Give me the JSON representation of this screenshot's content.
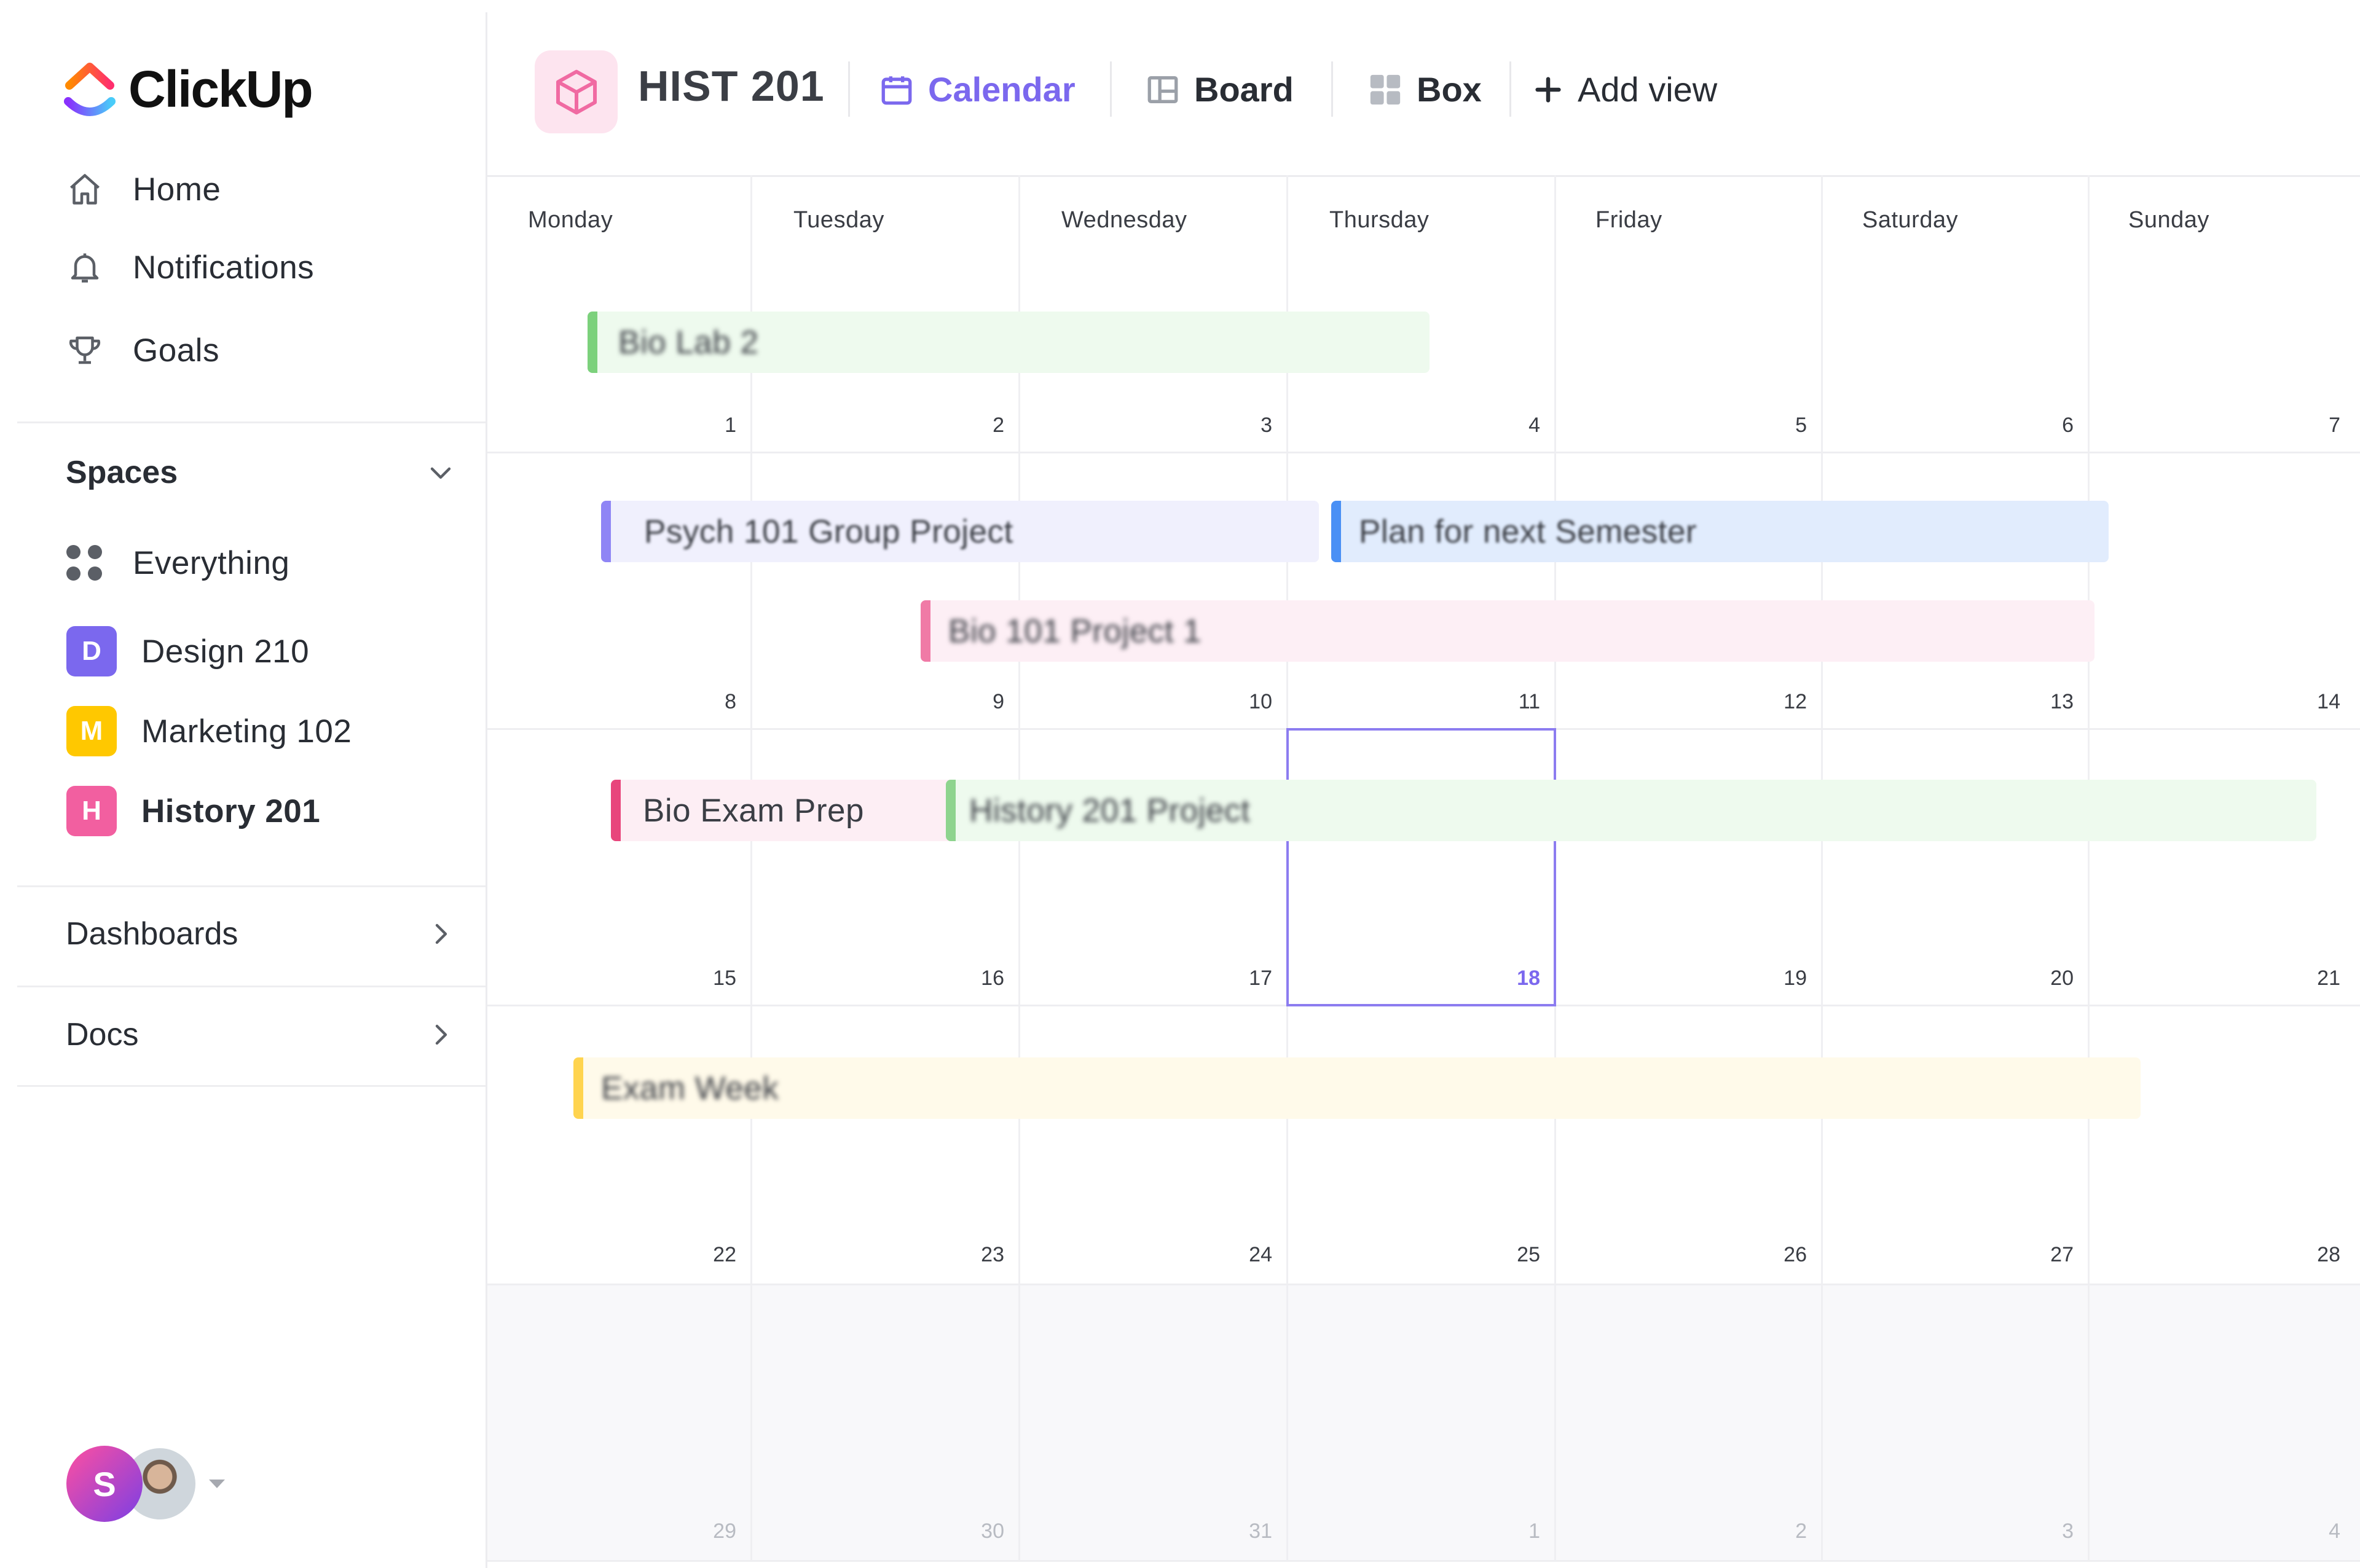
{
  "app": {
    "name": "ClickUp"
  },
  "sidebar": {
    "nav": [
      {
        "label": "Home",
        "icon": "home-icon"
      },
      {
        "label": "Notifications",
        "icon": "bell-icon"
      },
      {
        "label": "Goals",
        "icon": "trophy-icon"
      }
    ],
    "spaces_label": "Spaces",
    "spaces": [
      {
        "label": "Everything",
        "badge": "",
        "color": "",
        "icon": "grid-dots-icon"
      },
      {
        "label": "Design 210",
        "badge": "D",
        "color": "#7b68ee"
      },
      {
        "label": "Marketing 102",
        "badge": "M",
        "color": "#ffc800"
      },
      {
        "label": "History 201",
        "badge": "H",
        "color": "#f25fa0",
        "active": true
      }
    ],
    "dashboards_label": "Dashboards",
    "docs_label": "Docs",
    "user_initial": "S"
  },
  "header": {
    "project_title": "HIST 201",
    "project_icon": "cube-icon",
    "views": [
      {
        "label": "Calendar",
        "icon": "calendar-icon",
        "active": true
      },
      {
        "label": "Board",
        "icon": "board-icon"
      },
      {
        "label": "Box",
        "icon": "box-grid-icon"
      },
      {
        "label": "Add view",
        "icon": "plus-icon"
      }
    ]
  },
  "calendar": {
    "day_names": [
      "Monday",
      "Tuesday",
      "Wednesday",
      "Thursday",
      "Friday",
      "Saturday",
      "Sunday"
    ],
    "weeks": [
      [
        "1",
        "2",
        "3",
        "4",
        "5",
        "6",
        "7"
      ],
      [
        "8",
        "9",
        "10",
        "11",
        "12",
        "13",
        "14"
      ],
      [
        "15",
        "16",
        "17",
        "18",
        "19",
        "20",
        "21"
      ],
      [
        "22",
        "23",
        "24",
        "25",
        "26",
        "27",
        "28"
      ],
      [
        "29",
        "30",
        "31",
        "1",
        "2",
        "3",
        "4"
      ]
    ],
    "today": "18",
    "accent_color": "#7b68ee",
    "events": [
      {
        "title": "Bio Lab 2",
        "color": "#7cd17c",
        "bg": "#eefaee"
      },
      {
        "title": "Psych 101 Group Project",
        "color": "#8f85f5",
        "bg": "#f0f0fd"
      },
      {
        "title": "Plan for next Semester",
        "color": "#4a90f5",
        "bg": "#e1ecfd"
      },
      {
        "title": "Bio 101 Project 1",
        "color": "#f07aa6",
        "bg": "#fdeff5"
      },
      {
        "title": "Bio Exam Prep",
        "color": "#e8467c",
        "bg": "#fdeef4"
      },
      {
        "title": "History 201 Project",
        "color": "#8ed48e",
        "bg": "#eefaee"
      },
      {
        "title": "Exam Week",
        "color": "#ffd44f",
        "bg": "#fffaea"
      }
    ]
  }
}
